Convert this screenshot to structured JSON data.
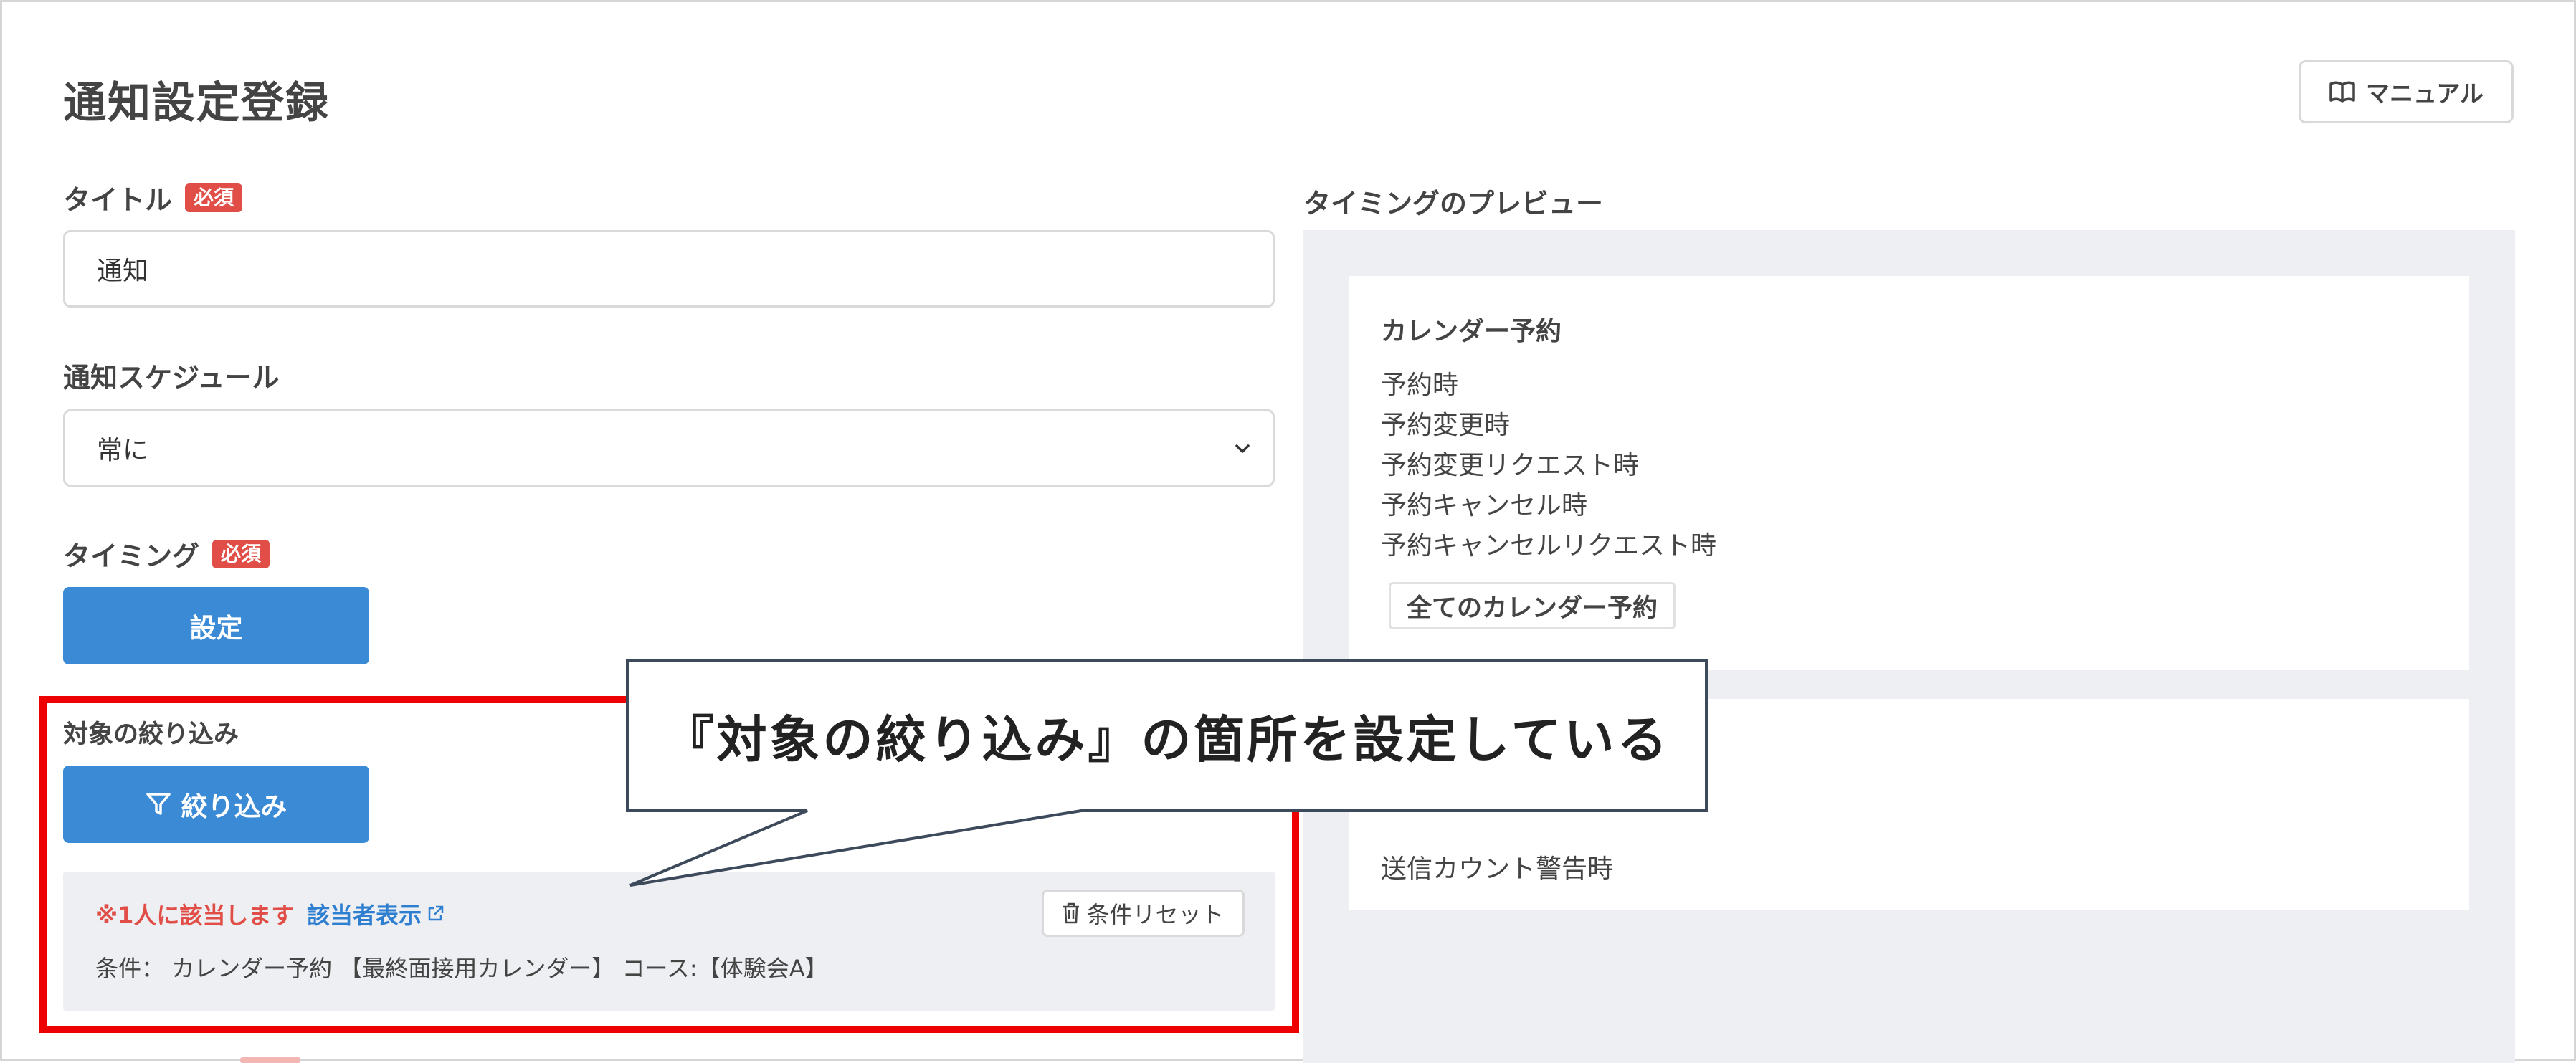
{
  "page": {
    "title": "通知設定登録",
    "manual_label": "マニュアル"
  },
  "form": {
    "title_label": "タイトル",
    "required_badge": "必須",
    "title_value": "通知",
    "schedule_label": "通知スケジュール",
    "schedule_value": "常に",
    "timing_label": "タイミング",
    "timing_button": "設定",
    "filter_label": "対象の絞り込み",
    "filter_button": "絞り込み",
    "filter_result": {
      "match_text": "※1人に該当します",
      "show_link": "該当者表示",
      "reset_button": "条件リセット",
      "condition_text": "条件： カレンダー予約 【最終面接用カレンダー】 コース:【体験会A】"
    }
  },
  "preview": {
    "label": "タイミングのプレビュー",
    "cards": [
      {
        "title": "カレンダー予約",
        "items": [
          "予約時",
          "予約変更時",
          "予約変更リクエスト時",
          "予約キャンセル時",
          "予約キャンセルリクエスト時"
        ],
        "tag": "全てのカレンダー予約"
      },
      {
        "items": [
          "送信カウント警告時"
        ]
      }
    ]
  },
  "annotation": {
    "callout_text": "『対象の絞り込み』の箇所を設定している",
    "highlight_color": "#ee0000"
  },
  "colors": {
    "primary": "#3a8ad6",
    "danger": "#e04e47",
    "link": "#2f7fd1",
    "panel_bg": "#eeeff2"
  }
}
